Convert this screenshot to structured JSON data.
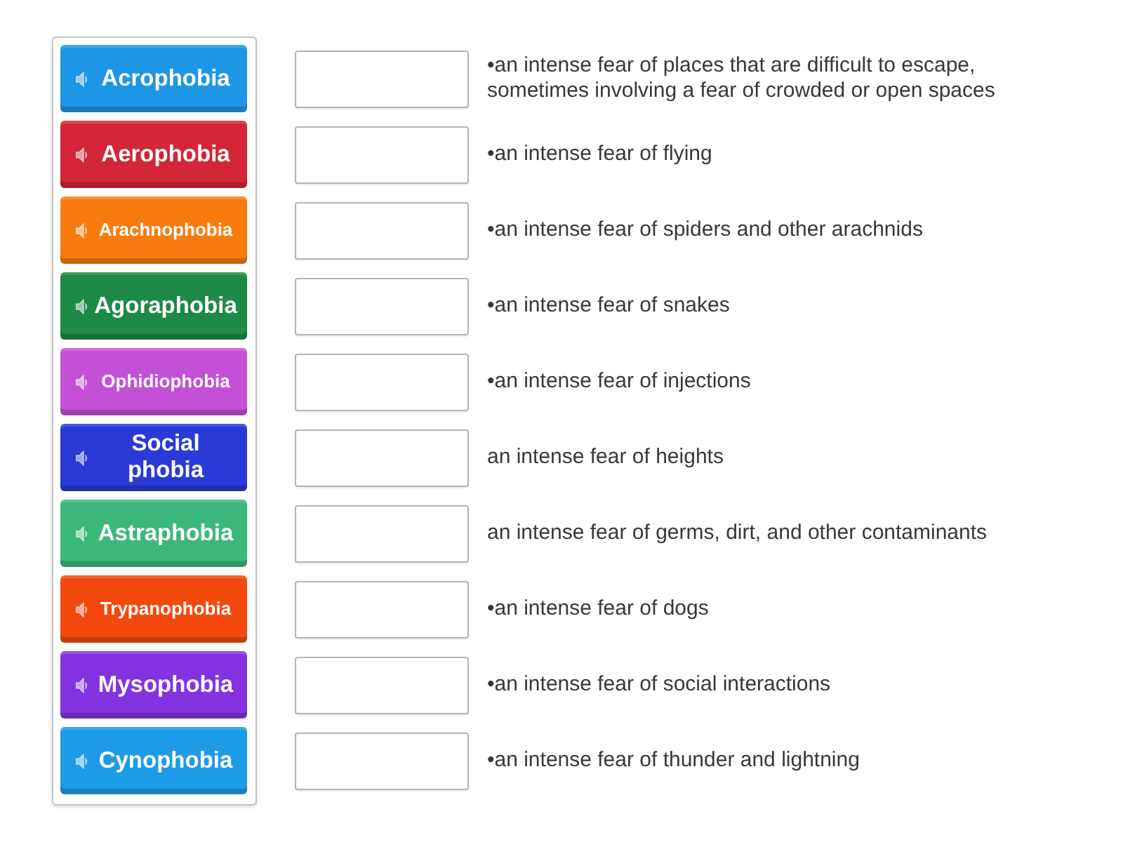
{
  "terms": [
    {
      "label": "Acrophobia",
      "color": "#1e96e6"
    },
    {
      "label": "Aerophobia",
      "color": "#d32638"
    },
    {
      "label": "Arachnophobia",
      "color": "#f77b0f"
    },
    {
      "label": "Agoraphobia",
      "color": "#1d8a45"
    },
    {
      "label": "Ophidiophobia",
      "color": "#c350d6"
    },
    {
      "label": "Social phobia",
      "color": "#2a3ad6"
    },
    {
      "label": "Astraphobia",
      "color": "#3cb87a"
    },
    {
      "label": "Trypanophobia",
      "color": "#f3490e"
    },
    {
      "label": "Mysophobia",
      "color": "#8433e0"
    },
    {
      "label": "Cynophobia",
      "color": "#1e9be6"
    }
  ],
  "definitions": [
    {
      "text": "•an intense fear of places that are difficult to escape, sometimes involving a fear of crowded or open spaces"
    },
    {
      "text": "•an intense fear of flying"
    },
    {
      "text": "•an intense fear of spiders and other arachnids"
    },
    {
      "text": "•an intense fear of snakes"
    },
    {
      "text": "•an intense fear of injections"
    },
    {
      "text": "an intense fear of heights"
    },
    {
      "text": "an intense fear of germs, dirt, and other contaminants"
    },
    {
      "text": "•an intense fear of dogs"
    },
    {
      "text": "•an intense fear of social interactions"
    },
    {
      "text": "•an intense fear of thunder and lightning"
    }
  ]
}
